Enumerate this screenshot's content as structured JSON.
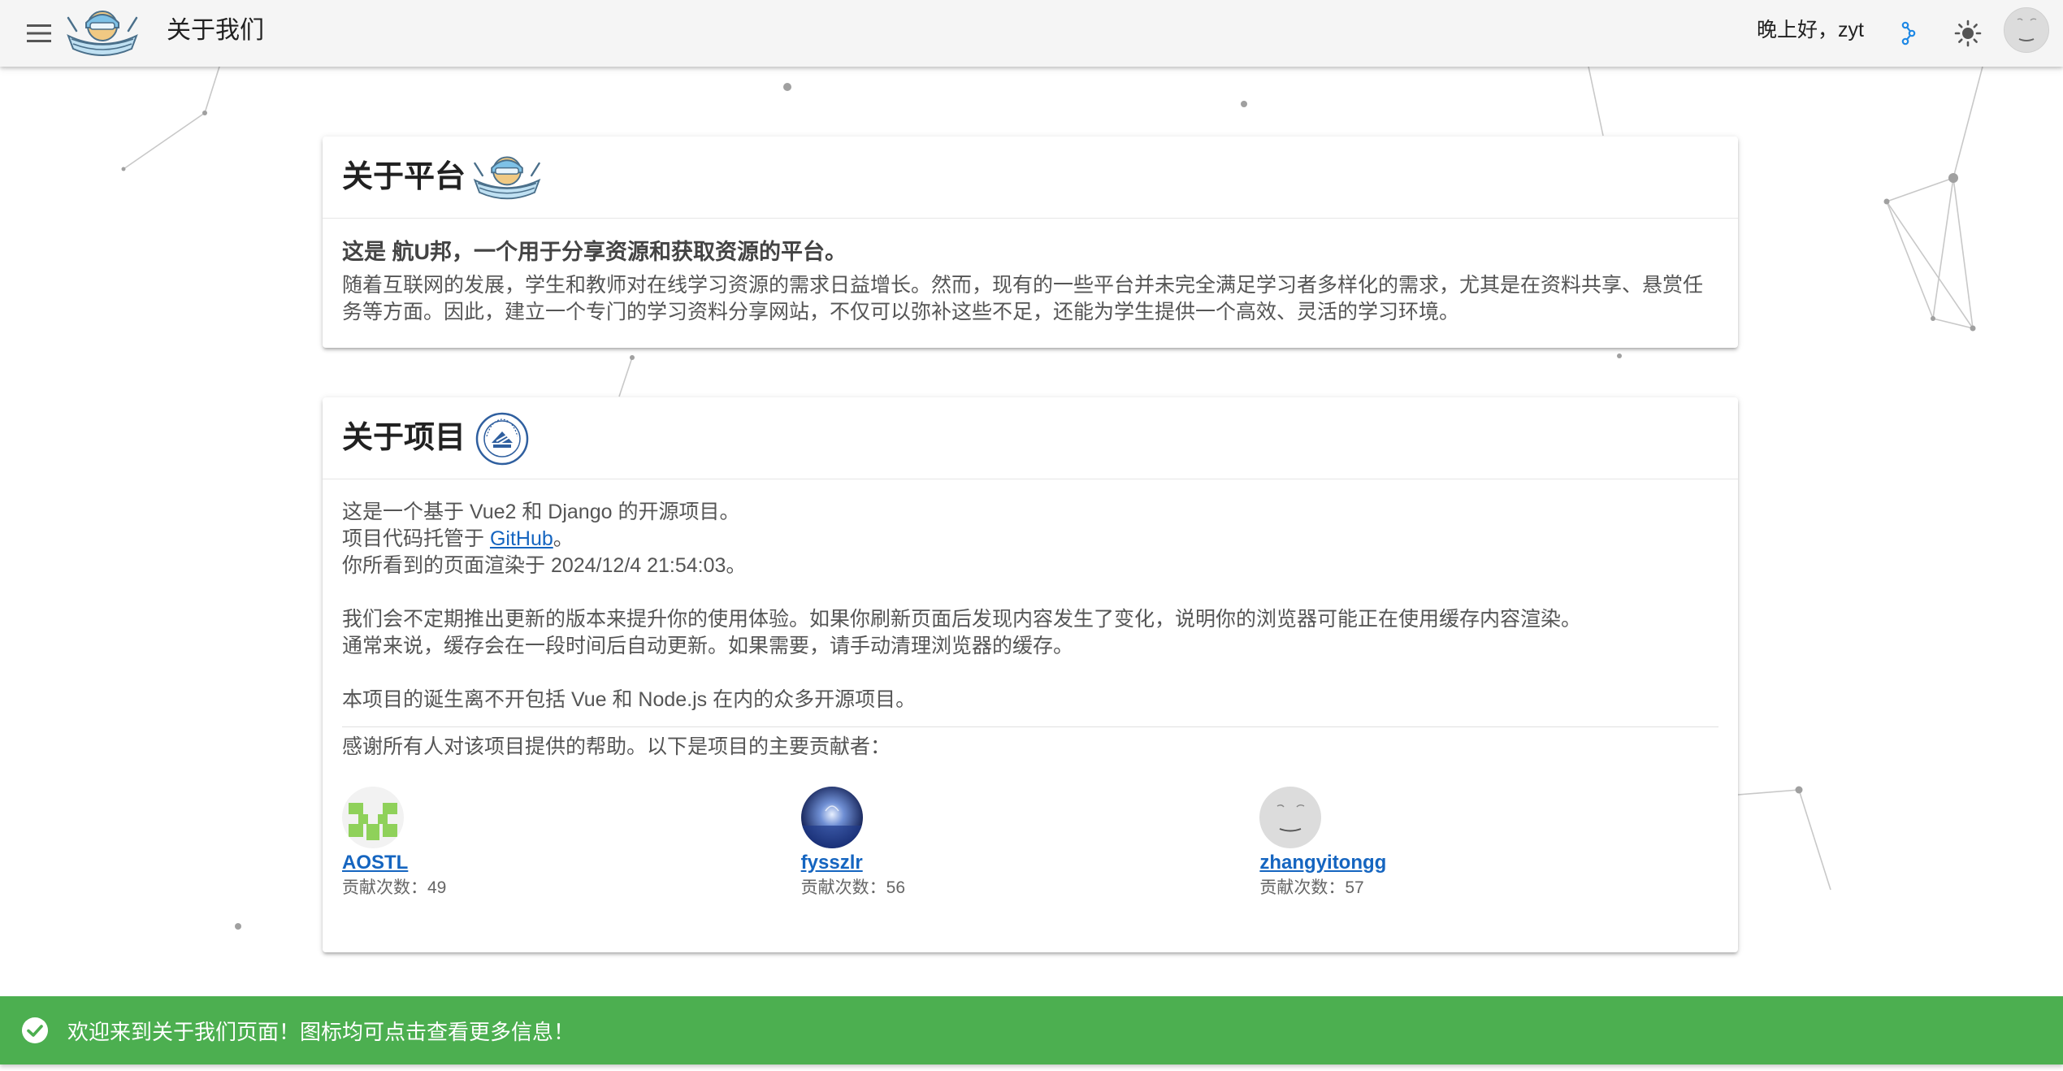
{
  "appbar": {
    "title": "关于我们",
    "greeting": "晚上好，zyt",
    "icons": {
      "menu": "menu-icon",
      "logo": "app-logo",
      "app_switch": "molecule-icon",
      "theme": "sun-icon",
      "avatar": "user-avatar"
    }
  },
  "platform": {
    "title": "关于平台",
    "lead": "这是 航U邦，一个用于分享资源和获取资源的平台。",
    "description": "随着互联网的发展，学生和教师对在线学习资源的需求日益增长。然而，现有的一些平台并未完全满足学习者多样化的需求，尤其是在资料共享、悬赏任务等方面。因此，建立一个专门的学习资料分享网站，不仅可以弥补这些不足，还能为学生提供一个高效、灵活的学习环境。"
  },
  "project": {
    "title": "关于项目",
    "line1": "这是一个基于 Vue2 和 Django 的开源项目。",
    "line2_prefix": "项目代码托管于 ",
    "line2_link": "GitHub",
    "line2_suffix": "。",
    "line3": "你所看到的页面渲染于 2024/12/4 21:54:03。",
    "line4": "我们会不定期推出更新的版本来提升你的使用体验。如果你刷新页面后发现内容发生了变化，说明你的浏览器可能正在使用缓存内容渲染。",
    "line5": "通常来说，缓存会在一段时间后自动更新。如果需要，请手动清理浏览器的缓存。",
    "line6": "本项目的诞生离不开包括 Vue 和 Node.js 在内的众多开源项目。",
    "thanks": "感谢所有人对该项目提供的帮助。以下是项目的主要贡献者：",
    "count_label": "贡献次数：",
    "contributors": [
      {
        "name": "AOSTL",
        "count": "49"
      },
      {
        "name": "fysszlr",
        "count": "56"
      },
      {
        "name": "zhangyitongg",
        "count": "57"
      }
    ]
  },
  "snackbar": {
    "message": "欢迎来到关于我们页面！图标均可点击查看更多信息！",
    "icon": "check-circle-icon"
  },
  "colors": {
    "appbar_bg": "#f5f5f5",
    "accent": "#1e88e5",
    "link": "#1565c0",
    "snackbar_bg": "#4caf50"
  }
}
